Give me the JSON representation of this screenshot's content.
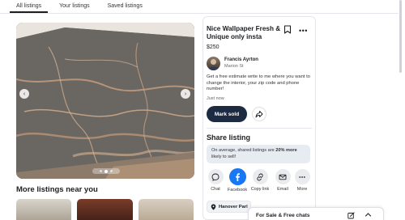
{
  "tabs": [
    {
      "label": "All listings"
    },
    {
      "label": "Your listings"
    },
    {
      "label": "Saved listings"
    }
  ],
  "photo": {
    "icon": "wallpaper-photo",
    "prev_icon": "chevron-left-icon",
    "next_icon": "chevron-right-icon",
    "page_count": 3,
    "active_page": 2
  },
  "more_listings": {
    "title": "More listings near you"
  },
  "listing": {
    "title": "Nice Wallpaper Fresh & Unique only insta",
    "price": "$250",
    "seller_name": "Francis Ayrton",
    "seller_location": "Marion St",
    "description": "Get a free estimate write to me where you want to change the interior, your zip code and phone number!",
    "posted": "Just now",
    "mark_sold_label": "Mark sold"
  },
  "share": {
    "title": "Share listing",
    "note_prefix": "On average, shared listings are ",
    "note_bold": "20% more",
    "note_suffix": " likely to sell!",
    "options": [
      {
        "label": "Chat",
        "icon": "chat-icon"
      },
      {
        "label": "Facebook",
        "icon": "facebook-icon"
      },
      {
        "label": "Copy link",
        "icon": "link-icon"
      },
      {
        "label": "Email",
        "icon": "email-icon"
      },
      {
        "label": "More",
        "icon": "more-icon"
      }
    ]
  },
  "location_chip": "Hanover Parl",
  "chat_bar": {
    "title": "For Sale & Free chats"
  },
  "colors": {
    "accent": "#1877f2",
    "mark_sold_bg": "#1c2b42",
    "share_note_bg": "#e7ecf3"
  }
}
